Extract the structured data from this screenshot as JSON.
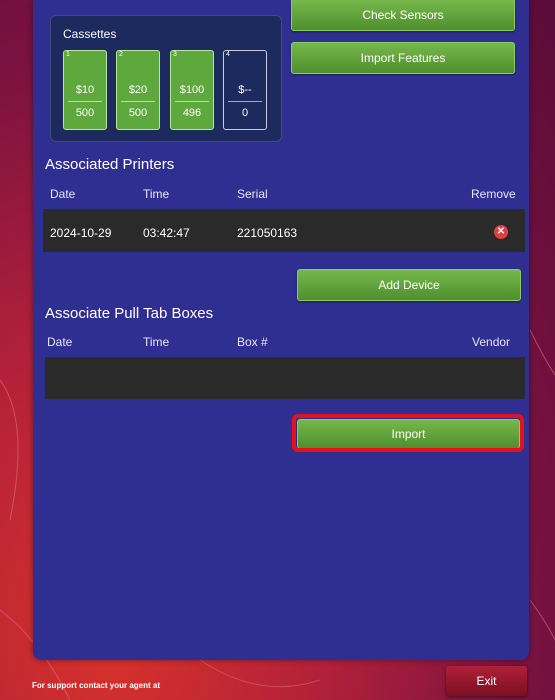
{
  "cassettes": {
    "title": "Cassettes",
    "items": [
      {
        "number": "1",
        "value": "$10",
        "count": "500"
      },
      {
        "number": "2",
        "value": "$20",
        "count": "500"
      },
      {
        "number": "3",
        "value": "$100",
        "count": "496"
      },
      {
        "number": "4",
        "value": "$--",
        "count": "0"
      }
    ]
  },
  "buttons": {
    "check_sensors": "Check Sensors",
    "import_features": "Import Features",
    "add_device": "Add Device",
    "import": "Import",
    "exit": "Exit"
  },
  "printers": {
    "title": "Associated Printers",
    "headers": {
      "date": "Date",
      "time": "Time",
      "serial": "Serial",
      "remove": "Remove"
    },
    "rows": [
      {
        "date": "2024-10-29",
        "time": "03:42:47",
        "serial": "221050163"
      }
    ]
  },
  "pulltabs": {
    "title": "Associate Pull Tab Boxes",
    "headers": {
      "date": "Date",
      "time": "Time",
      "box": "Box #",
      "vendor": "Vendor"
    }
  },
  "footer": {
    "support_text": "For support contact your agent at"
  },
  "colors": {
    "panel": "#2f2f91",
    "button_green": "#5fa83e",
    "highlight": "#e8101a",
    "exit_red": "#9a1a2c"
  }
}
